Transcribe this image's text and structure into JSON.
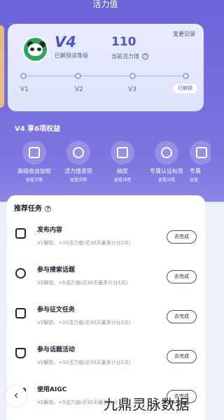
{
  "header": {
    "title": "活力值"
  },
  "level_card": {
    "level": "V4",
    "level_status": "已解锁该等级",
    "current_score": "110",
    "current_score_label": "当前活力值",
    "change_log": "变更记录",
    "ticks": [
      "V1",
      "V2",
      "V3"
    ],
    "unlocked_badge": "已解锁"
  },
  "benefits": {
    "title": "V4 享6项权益",
    "items": [
      {
        "label": "高级收益加权",
        "detail": "查看详情",
        "icon": "gift-box-icon"
      },
      {
        "label": "活力值变现",
        "detail": "查看详情",
        "icon": "coin-icon"
      },
      {
        "label": "抽奖",
        "detail": "查看详情",
        "icon": "lottery-icon"
      },
      {
        "label": "专属认证标签",
        "detail": "查看详情",
        "icon": "badge-icon"
      },
      {
        "label": "专属",
        "detail": "查看",
        "icon": "star-icon"
      }
    ]
  },
  "tasks": {
    "title": "推荐任务",
    "items": [
      {
        "title": "发布内容",
        "desc": "V1解锁，+10活力值(近30天最多计分2次)",
        "button": "去完成",
        "icon": "publish-icon"
      },
      {
        "title": "参与搜索话题",
        "desc": "V2解锁，+5活力值(近30天最多计分1次)",
        "button": "去完成",
        "icon": "search-icon"
      },
      {
        "title": "参与征文任务",
        "desc": "V2解锁，+10活力值(近30天最多计分2次)",
        "button": "去完成",
        "icon": "document-icon"
      },
      {
        "title": "参与话题活动",
        "desc": "V2解锁，+10活力值(近30天最多计分2次)",
        "button": "去完成",
        "icon": "crown-icon"
      },
      {
        "title": "使用AIGC",
        "desc": "V2解锁，+5活力值(近30天最多计分",
        "button": "去完成",
        "icon": "aigc-icon"
      }
    ]
  },
  "watermark": "九鼎灵脉数据"
}
